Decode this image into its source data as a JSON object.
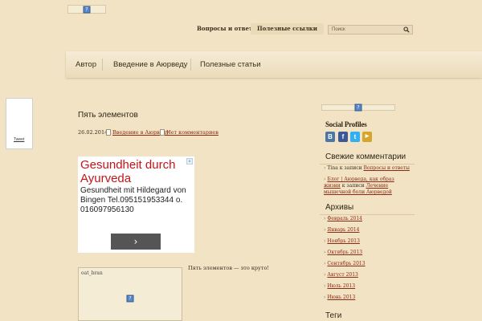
{
  "header": {
    "top_links": [
      "Вопросы и ответы",
      "Полезные ссылки"
    ],
    "search_placeholder": "Поиск"
  },
  "nav": {
    "items": [
      "Автор",
      "Введение в Аюрведу",
      "Полезные статьи"
    ]
  },
  "tweet_widget": {
    "label": "Tweet"
  },
  "post": {
    "title": "Пять элементов",
    "date": "26.02.2014,",
    "category": "Введение в Аюрведу",
    "comments": "Нет комментариев",
    "intro_text": "Пять элементов — это круто!",
    "image_alt": "oat_bran"
  },
  "ad": {
    "title": "Gesundheit durch Ayurveda",
    "body": "Gesundheit mit Hildegard von Bingen Tel.095151953344 o. 016097956130",
    "next_glyph": "›"
  },
  "sidebar": {
    "social_title": "Social Profiles",
    "social_icons": [
      {
        "name": "vk-icon",
        "glyph": "В",
        "color": "#4b77a7"
      },
      {
        "name": "facebook-icon",
        "glyph": "f",
        "color": "#3b5998"
      },
      {
        "name": "twitter-icon",
        "glyph": "t",
        "color": "#33aef0"
      },
      {
        "name": "youtube-icon",
        "glyph": "▶",
        "color": "#d6a52a"
      }
    ],
    "comments_title": "Свежие комментарии",
    "comment1_author": "Tina",
    "comment1_mid": "к записи",
    "comment1_link": "Вопросы и ответы",
    "comment2_author": "Блог | Аюрведа, как образ жизни",
    "comment2_mid": "к записи",
    "comment2_link": "Лечение мышечной боли Аюрведой",
    "archives_title": "Архивы",
    "archives": [
      "Февраль 2014",
      "Январь 2014",
      "Ноябрь 2013",
      "Октябрь 2013",
      "Сентябрь 2013",
      "Август 2013",
      "Июль 2013",
      "Июнь 2013"
    ],
    "tags_title": "Теги"
  }
}
